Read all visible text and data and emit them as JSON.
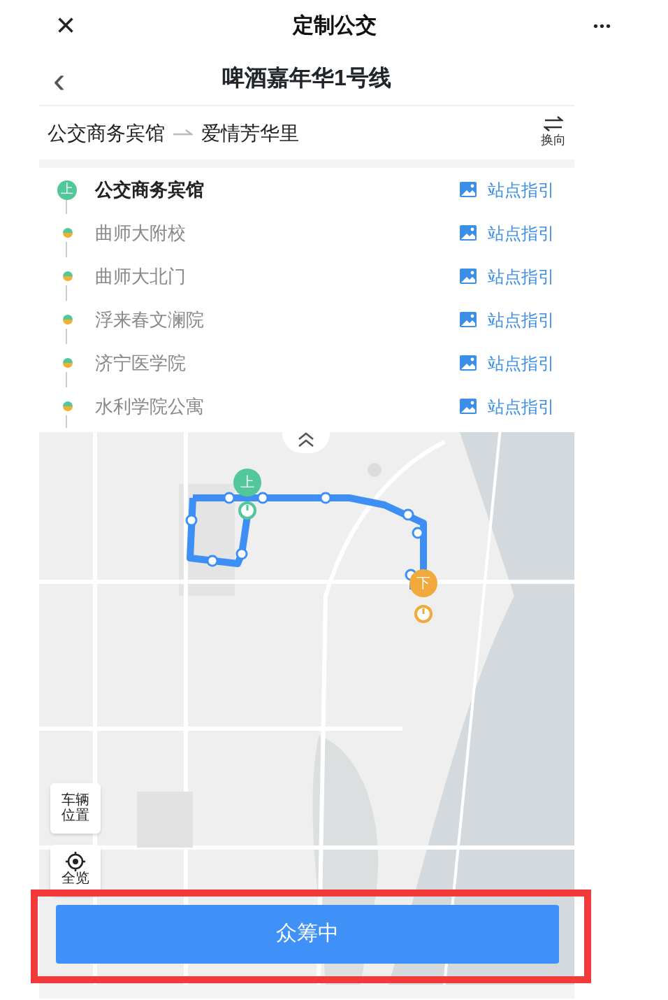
{
  "top_bar": {
    "close": "×",
    "title": "定制公交",
    "more": "•••"
  },
  "nav_bar": {
    "back": "‹",
    "title": "啤酒嘉年华1号线"
  },
  "route": {
    "from": "公交商务宾馆",
    "to": "爱情芳华里",
    "swap_label": "换向"
  },
  "stops": [
    {
      "name": "公交商务宾馆",
      "kind": "boarding",
      "badge": "上",
      "guide": "站点指引"
    },
    {
      "name": "曲师大附校",
      "kind": "stop",
      "guide": "站点指引"
    },
    {
      "name": "曲师大北门",
      "kind": "stop",
      "guide": "站点指引"
    },
    {
      "name": "浮来春文澜院",
      "kind": "stop",
      "guide": "站点指引"
    },
    {
      "name": "济宁医学院",
      "kind": "stop",
      "guide": "站点指引"
    },
    {
      "name": "水利学院公寓",
      "kind": "stop",
      "guide": "站点指引"
    }
  ],
  "map": {
    "board_marker": "上",
    "alight_marker": "下",
    "vehicle_button": "车辆位置",
    "overview_button": "全览"
  },
  "action_button": {
    "label": "众筹中",
    "highlighted": true
  }
}
